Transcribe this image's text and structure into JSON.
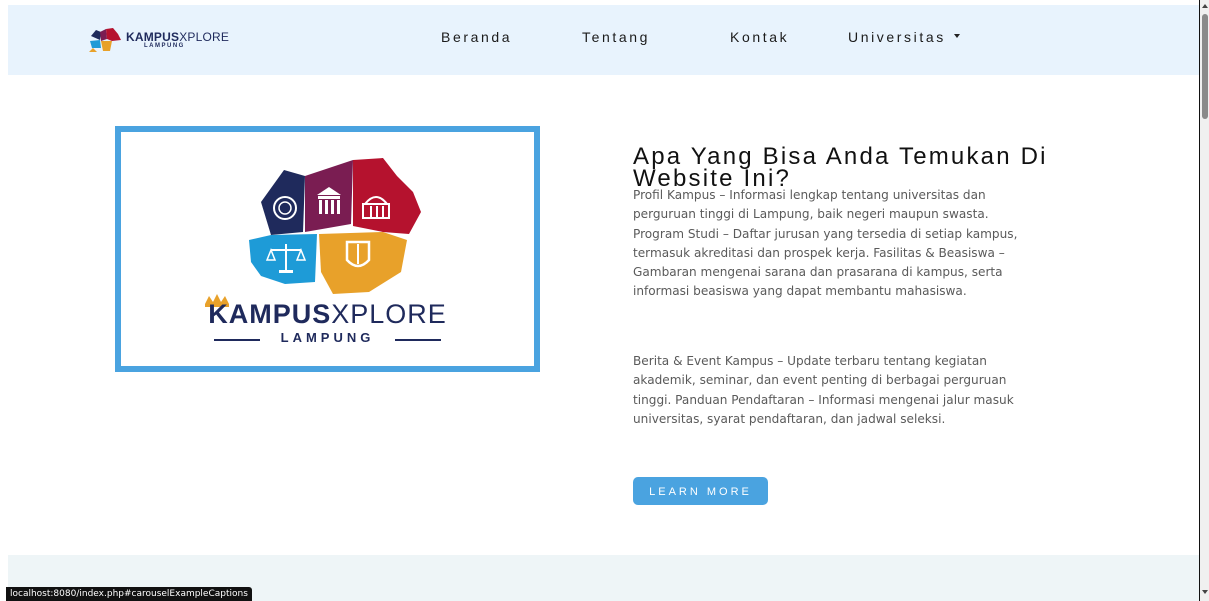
{
  "brand": {
    "name_bold": "KAMPUS",
    "name_light": "XPLORE",
    "region": "LAMPUNG"
  },
  "nav": {
    "items": [
      {
        "label": "Beranda"
      },
      {
        "label": "Tentang"
      },
      {
        "label": "Kontak"
      },
      {
        "label": "Universitas"
      }
    ]
  },
  "hero": {
    "logo_bold": "KAMPUS",
    "logo_light": "XPLORE",
    "logo_sub": "LAMPUNG"
  },
  "about": {
    "title": "Apa Yang Bisa Anda Temukan Di Website Ini?",
    "paragraph1": "Profil Kampus – Informasi lengkap tentang universitas dan perguruan tinggi di Lampung, baik negeri maupun swasta. Program Studi – Daftar jurusan yang tersedia di setiap kampus, termasuk akreditasi dan prospek kerja. Fasilitas & Beasiswa – Gambaran mengenai sarana dan prasarana di kampus, serta informasi beasiswa yang dapat membantu mahasiswa.",
    "paragraph2": "Berita & Event Kampus – Update terbaru tentang kegiatan akademik, seminar, dan event penting di berbagai perguruan tinggi. Panduan Pendaftaran – Informasi mengenai jalur masuk universitas, syarat pendaftaran, dan jadwal seleksi.",
    "button_label": "LEARN MORE"
  },
  "status_bar": {
    "url": "localhost:8080/index.php#carouselExampleCaptions"
  },
  "colors": {
    "accent": "#4aa3e0",
    "navbar_bg": "#e8f3fd",
    "logo_navy": "#1f2a5c",
    "logo_crimson": "#b5122e",
    "logo_purple": "#7a1d52",
    "logo_cyan": "#1e9bd7",
    "logo_orange": "#e8a12a"
  }
}
